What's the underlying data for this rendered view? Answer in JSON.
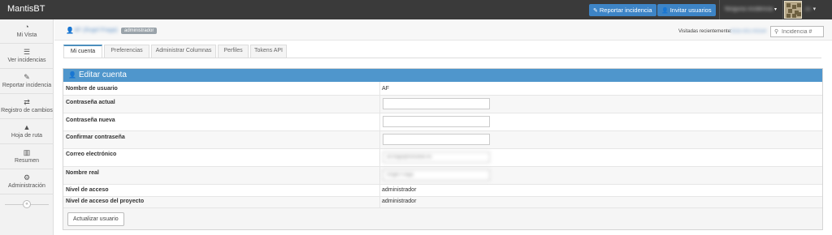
{
  "app": {
    "brand": "MantisBT"
  },
  "navbar": {
    "report_button": "Reportar incidencia",
    "invite_button": "Invitar usuarios",
    "project_selector": "Ninguna incidencia",
    "user_caret": "▾"
  },
  "sidebar": {
    "items": [
      {
        "label": "Mi Vista",
        "icon": "dashboard-icon"
      },
      {
        "label": "Ver incidencias",
        "icon": "list-icon"
      },
      {
        "label": "Reportar incidencia",
        "icon": "edit-icon"
      },
      {
        "label": "Registro de cambios",
        "icon": "retweet-icon"
      },
      {
        "label": "Hoja de ruta",
        "icon": "road-icon"
      },
      {
        "label": "Resumen",
        "icon": "bar-chart-icon"
      },
      {
        "label": "Administración",
        "icon": "gears-icon"
      }
    ],
    "collapse_icon": "«"
  },
  "breadcrumb": {
    "user_name": "AF (Ángel Fraga)",
    "badge": "administrador",
    "recent_label": "Visitadas recientemente:",
    "recent_value": "0025-001-00154",
    "search_placeholder": "Incidencia #"
  },
  "tabs": [
    {
      "label": "Mi cuenta",
      "active": true
    },
    {
      "label": "Preferencias",
      "active": false
    },
    {
      "label": "Administrar Columnas",
      "active": false
    },
    {
      "label": "Perfiles",
      "active": false
    },
    {
      "label": "Tokens API",
      "active": false
    }
  ],
  "form": {
    "title": "Editar cuenta",
    "rows": [
      {
        "label": "Nombre de usuario",
        "value": "AF"
      },
      {
        "label": "Contraseña actual",
        "value": ""
      },
      {
        "label": "Contraseña nueva",
        "value": ""
      },
      {
        "label": "Confirmar contraseña",
        "value": ""
      },
      {
        "label": "Correo electrónico",
        "value": "af.fraga@estudiar.es"
      },
      {
        "label": "Nombre real",
        "value": "Ángel Fraga"
      },
      {
        "label": "Nivel de acceso",
        "value": "administrador"
      },
      {
        "label": "Nivel de acceso del proyecto",
        "value": "administrador"
      }
    ],
    "submit": "Actualizar usuario"
  },
  "colors": {
    "navbar": "#3a3a3a",
    "primary_button": "#3d84c6",
    "widget_header": "#4f96cc",
    "active_tab_border": "#4c8fbd",
    "link": "#5a8ec5"
  }
}
